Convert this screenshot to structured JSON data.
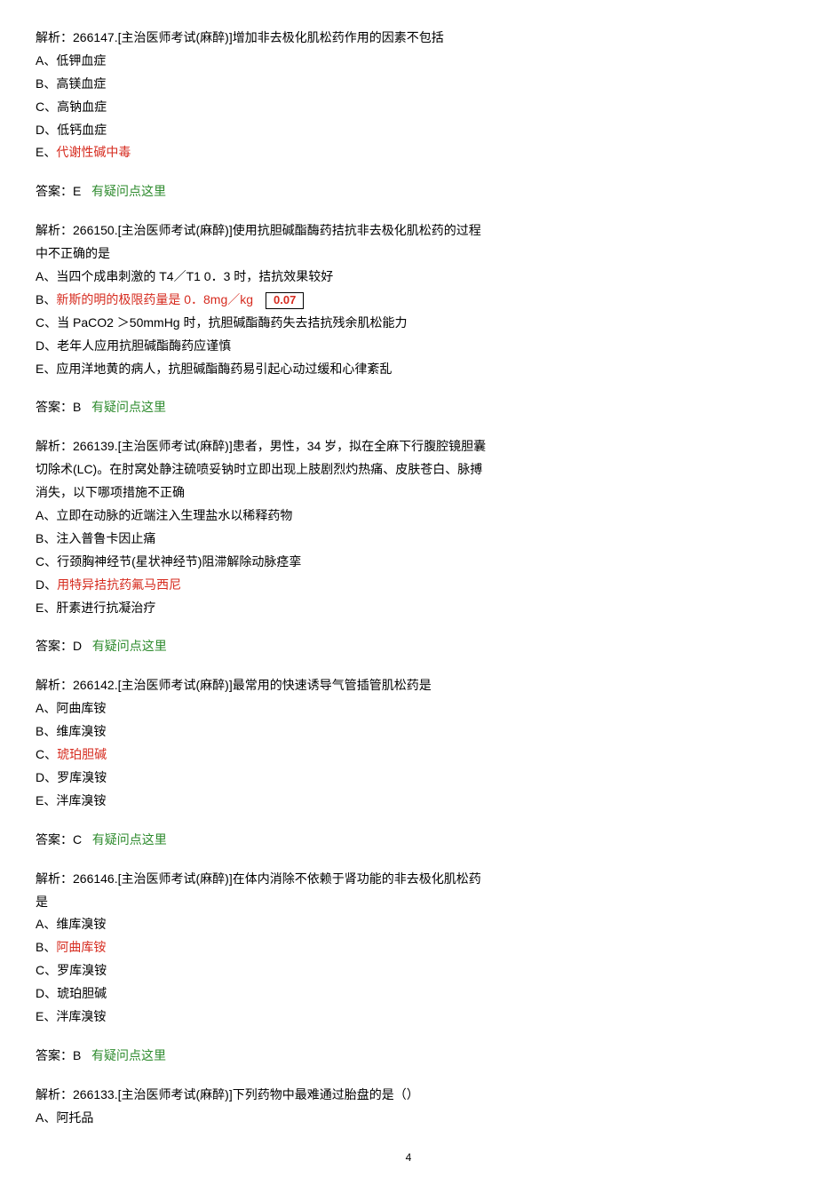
{
  "questions": [
    {
      "stem_prefix": "解析：266147.[主治医师考试(麻醉)]增加非去极化肌松药作用的因素不包括",
      "options": [
        {
          "text": "A、低钾血症",
          "red": false
        },
        {
          "text": "B、高镁血症",
          "red": false
        },
        {
          "text": "C、高钠血症",
          "red": false
        },
        {
          "text": "D、低钙血症",
          "red": false
        },
        {
          "text": "E、",
          "red_tail": "代谢性碱中毒"
        }
      ],
      "answer": "答案：E",
      "help": "有疑问点这里"
    },
    {
      "stem_prefix": "解析：266150.[主治医师考试(麻醉)]使用抗胆碱酯酶药拮抗非去极化肌松药的过程中不正确的是",
      "options": [
        {
          "text": "A、当四个成串刺激的 T4／T1 0．3 时，拮抗效果较好",
          "red": false
        },
        {
          "text": "B、",
          "red_tail": "新斯的明的极限药量是 0．8mg／kg",
          "box": "0.07"
        },
        {
          "text": "C、当 PaCO2 ＞50mmHg 时，抗胆碱酯酶药失去拮抗残余肌松能力",
          "red": false
        },
        {
          "text": "D、老年人应用抗胆碱酯酶药应谨慎",
          "red": false
        },
        {
          "text": "E、应用洋地黄的病人，抗胆碱酯酶药易引起心动过缓和心律紊乱",
          "red": false
        }
      ],
      "answer": "答案：B",
      "help": "有疑问点这里"
    },
    {
      "stem_prefix": "解析：266139.[主治医师考试(麻醉)]患者，男性，34 岁，拟在全麻下行腹腔镜胆囊切除术(LC)。在肘窝处静注硫喷妥钠时立即出现上肢剧烈灼热痛、皮肤苍白、脉搏消失，以下哪项措施不正确",
      "options": [
        {
          "text": "A、立即在动脉的近端注入生理盐水以稀释药物",
          "red": false
        },
        {
          "text": "B、注入普鲁卡因止痛",
          "red": false
        },
        {
          "text": "C、行颈胸神经节(星状神经节)阻滞解除动脉痉挛",
          "red": false
        },
        {
          "text": "D、",
          "red_tail": "用特异拮抗药氟马西尼"
        },
        {
          "text": "E、肝素进行抗凝治疗",
          "red": false
        }
      ],
      "answer": "答案：D",
      "help": "有疑问点这里"
    },
    {
      "stem_prefix": "解析：266142.[主治医师考试(麻醉)]最常用的快速诱导气管插管肌松药是",
      "options": [
        {
          "text": "A、阿曲库铵",
          "red": false
        },
        {
          "text": "B、维库溴铵",
          "red": false
        },
        {
          "text": "C、",
          "red_tail": "琥珀胆碱"
        },
        {
          "text": "D、罗库溴铵",
          "red": false
        },
        {
          "text": "E、泮库溴铵",
          "red": false
        }
      ],
      "answer": "答案：C",
      "help": "有疑问点这里"
    },
    {
      "stem_prefix": "解析：266146.[主治医师考试(麻醉)]在体内消除不依赖于肾功能的非去极化肌松药是",
      "options": [
        {
          "text": "A、维库溴铵",
          "red": false
        },
        {
          "text": "B、",
          "red_tail": "阿曲库铵"
        },
        {
          "text": "C、罗库溴铵",
          "red": false
        },
        {
          "text": "D、琥珀胆碱",
          "red": false
        },
        {
          "text": "E、泮库溴铵",
          "red": false
        }
      ],
      "answer": "答案：B",
      "help": "有疑问点这里"
    },
    {
      "stem_prefix": "解析：266133.[主治医师考试(麻醉)]下列药物中最难通过胎盘的是（）",
      "options": [
        {
          "text": "A、阿托品",
          "red": false
        }
      ]
    }
  ],
  "page_number": "4"
}
